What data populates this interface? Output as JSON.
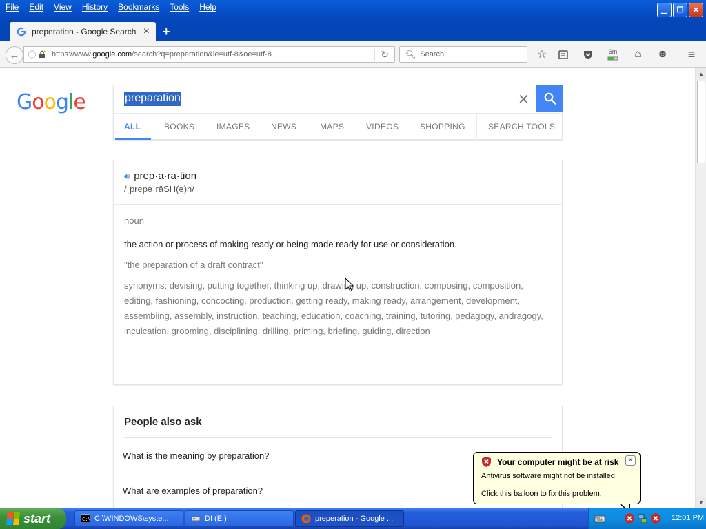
{
  "browser": {
    "menu": [
      "File",
      "Edit",
      "View",
      "History",
      "Bookmarks",
      "Tools",
      "Help"
    ],
    "tab_title": "preperation - Google Search",
    "url_prefix": "https://www.",
    "url_domain": "google.com",
    "url_path": "/search?q=preperation&ie=utf-8&oe=utf-8",
    "search_placeholder": "Search",
    "download_badge": "6m"
  },
  "google": {
    "logo_letters": [
      "G",
      "o",
      "o",
      "g",
      "l",
      "e"
    ],
    "query": "preparation",
    "tabs": [
      "ALL",
      "BOOKS",
      "IMAGES",
      "NEWS",
      "MAPS",
      "VIDEOS",
      "SHOPPING",
      "SEARCH TOOLS"
    ],
    "active_tab": "ALL"
  },
  "dictionary": {
    "word": "prep·a·ra·tion",
    "phonetic": "/ˌprepəˈrāSH(ə)n/",
    "part_of_speech": "noun",
    "definition": "the action or process of making ready or being made ready for use or consideration.",
    "example": "\"the preparation of a draft contract\"",
    "synonyms_label": "synonyms:",
    "synonyms": "devising, putting together, thinking up, drawing up, construction, composing, composition, editing, fashioning, concocting, production, getting ready, making ready, arrangement, development, assembling, assembly, instruction, teaching, education, coaching, training, tutoring, pedagogy, andragogy, inculcation, grooming, disciplining, drilling, priming, briefing, guiding, direction"
  },
  "people_also_ask": {
    "title": "People also ask",
    "questions": [
      "What is the meaning by preparation?",
      "What are examples of preparation?"
    ]
  },
  "balloon": {
    "title": "Your computer might be at risk",
    "line1": "Antivirus software might not be installed",
    "line2": "Click this balloon to fix this problem."
  },
  "taskbar": {
    "start_label": "start",
    "buttons": [
      "C:\\WINDOWS\\syste...",
      "DI (E:)",
      "preperation - Google ..."
    ],
    "clock": "12:01 PM"
  },
  "colors": {
    "google_blue": "#4285f4",
    "xp_blue": "#0a5fd6",
    "balloon_bg": "#ffffe1"
  }
}
